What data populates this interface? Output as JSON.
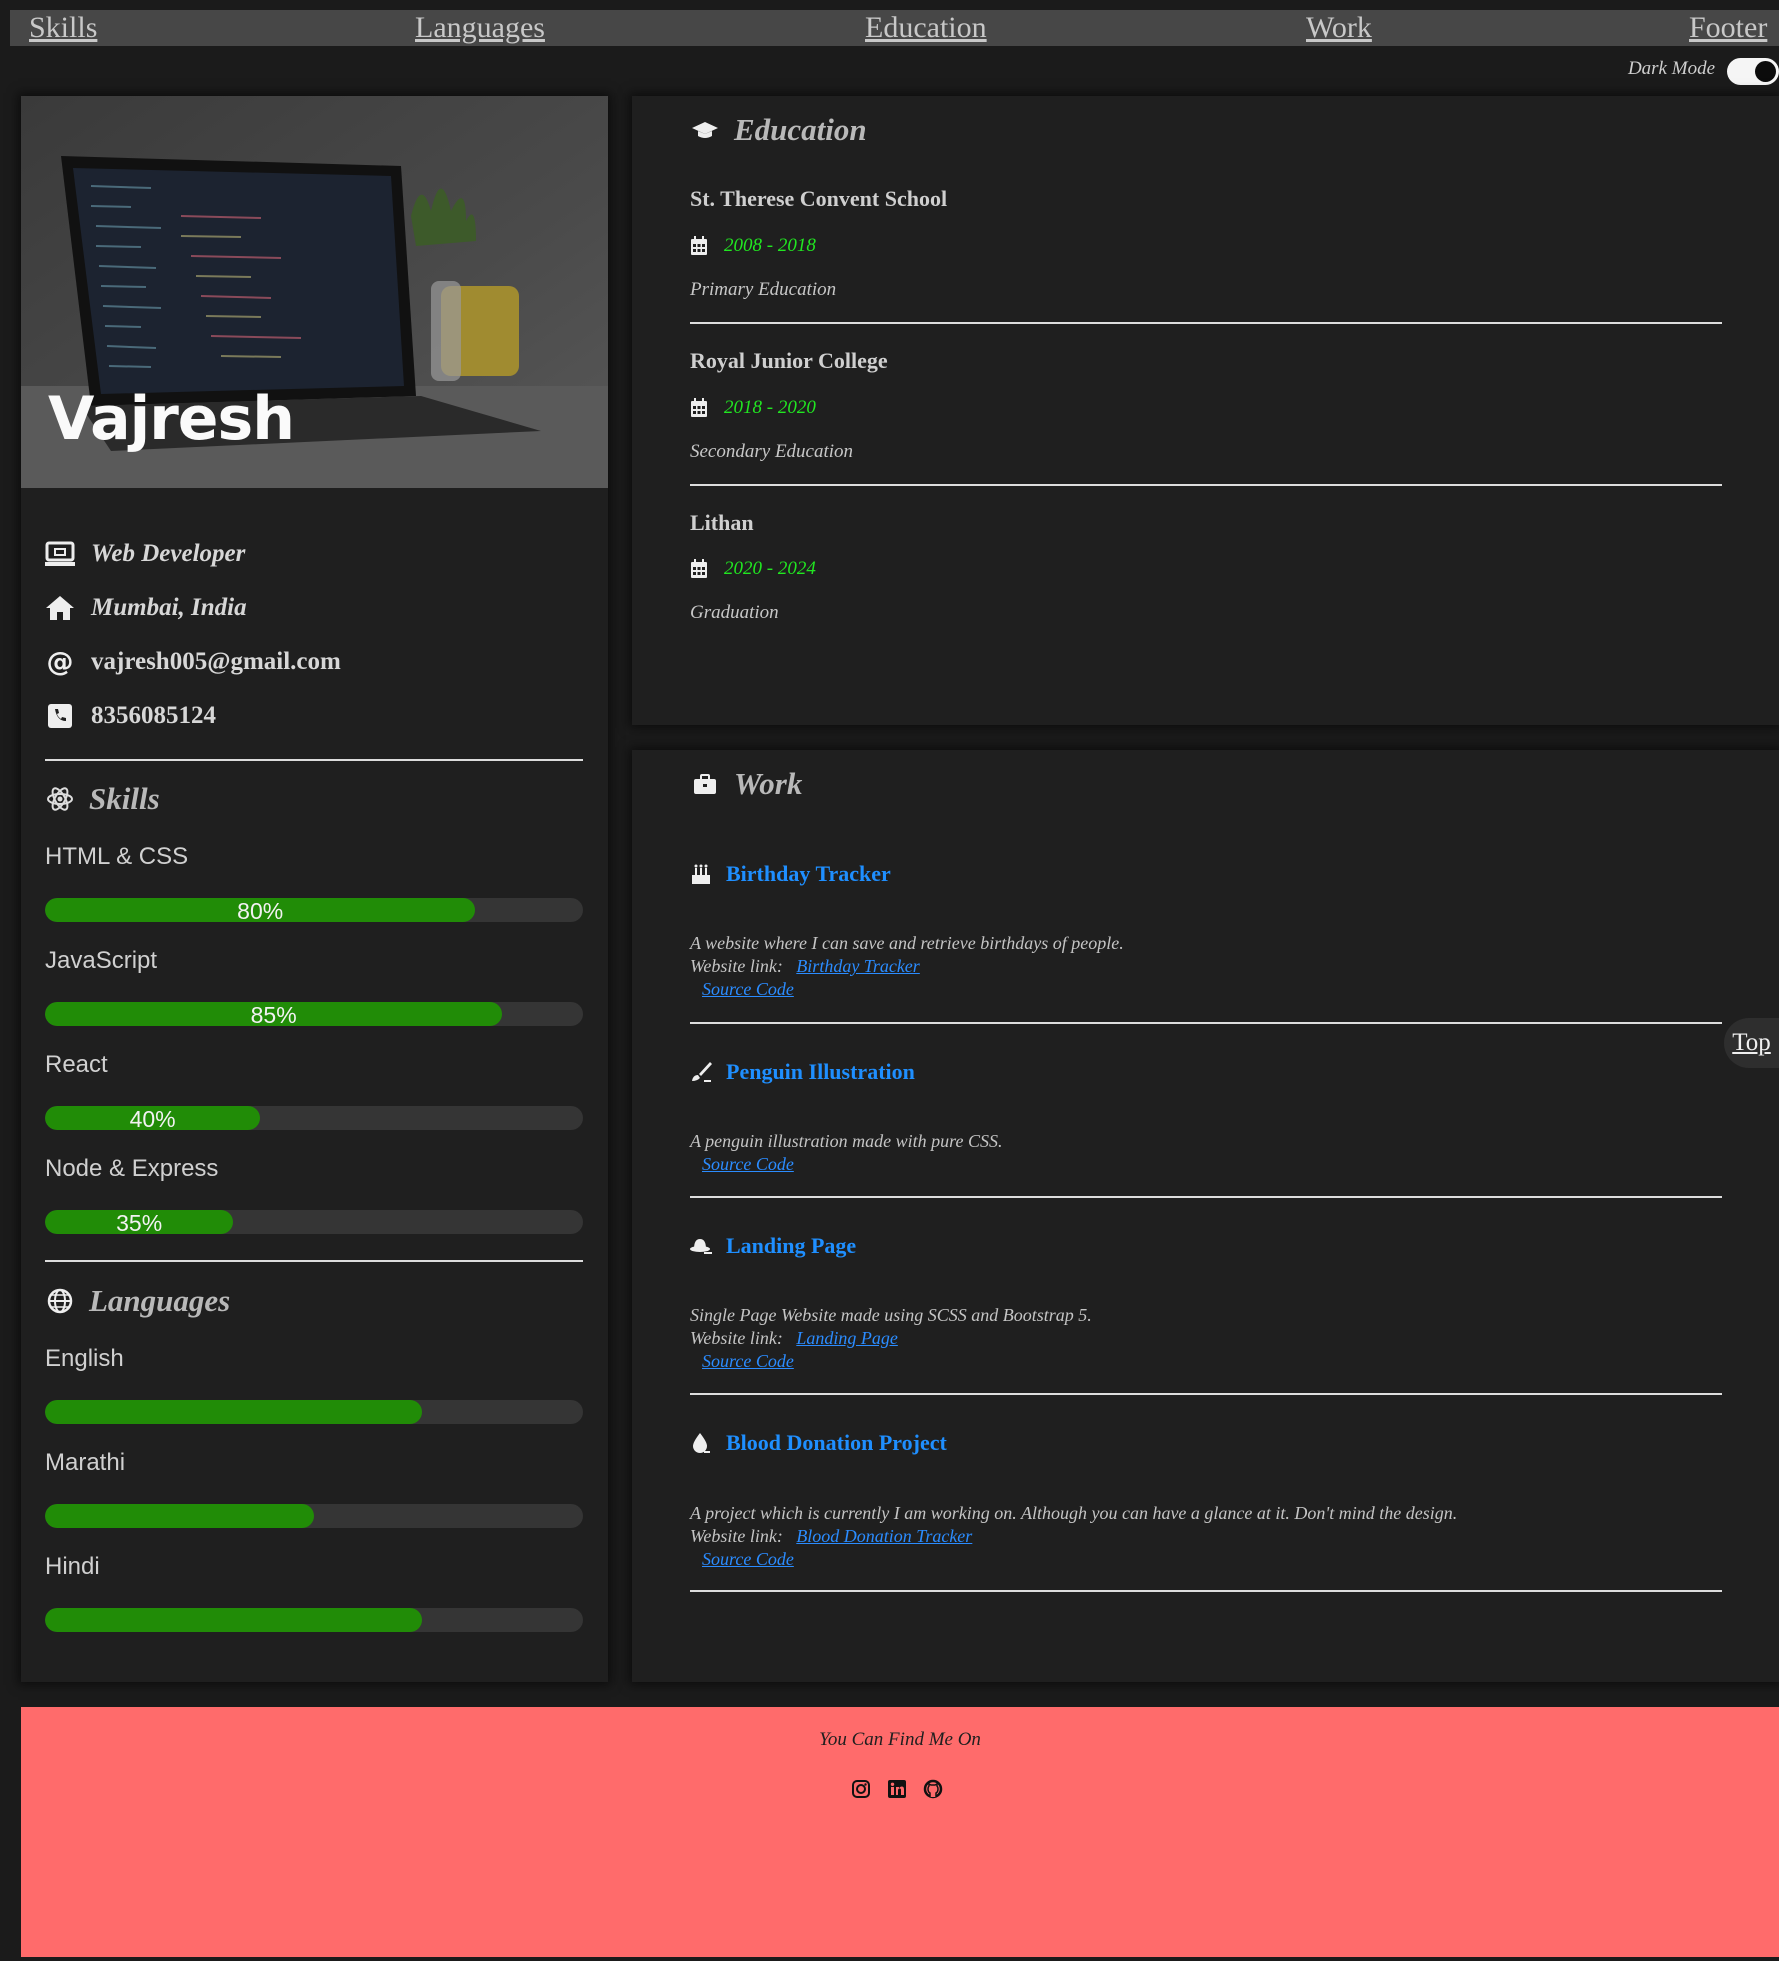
{
  "nav": {
    "items": [
      "Skills",
      "Languages",
      "Education",
      "Work",
      "Footer"
    ]
  },
  "dark_mode": {
    "label": "Dark Mode",
    "enabled": true
  },
  "profile": {
    "name": "Vajresh",
    "hero_icon": "laptop-photo",
    "info": [
      {
        "icon": "computer-icon",
        "text": "Web Developer"
      },
      {
        "icon": "home-icon",
        "text": "Mumbai, India"
      },
      {
        "icon": "at-icon",
        "text": "vajresh005@gmail.com"
      },
      {
        "icon": "phone-icon",
        "text": "8356085124"
      }
    ]
  },
  "skills": {
    "title": "Skills",
    "items": [
      {
        "name": "HTML & CSS",
        "percent": 80,
        "label": "80%"
      },
      {
        "name": "JavaScript",
        "percent": 85,
        "label": "85%"
      },
      {
        "name": "React",
        "percent": 40,
        "label": "40%"
      },
      {
        "name": "Node & Express",
        "percent": 35,
        "label": "35%"
      }
    ]
  },
  "languages": {
    "title": "Languages",
    "items": [
      {
        "name": "English",
        "percent": 70
      },
      {
        "name": "Marathi",
        "percent": 50
      },
      {
        "name": "Hindi",
        "percent": 70
      }
    ]
  },
  "education": {
    "title": "Education",
    "entries": [
      {
        "school": "St. Therese Convent School",
        "years": "2008 - 2018",
        "desc": "Primary Education"
      },
      {
        "school": "Royal Junior College",
        "years": "2018 - 2020",
        "desc": "Secondary Education"
      },
      {
        "school": "Lithan",
        "years": "2020 - 2024",
        "desc": "Graduation"
      }
    ]
  },
  "work": {
    "title": "Work",
    "link_prefix": "Website link:",
    "projects": [
      {
        "icon": "cake-icon",
        "title": "Birthday Tracker",
        "desc": "A website where I can save and retrieve birthdays of people.",
        "website_link": "Birthday Tracker",
        "source": "Source Code"
      },
      {
        "icon": "brush-icon",
        "title": "Penguin Illustration",
        "desc": "A penguin illustration made with pure CSS.",
        "website_link": null,
        "source": "Source Code"
      },
      {
        "icon": "hat-icon",
        "title": "Landing Page",
        "desc": "Single Page Website made using SCSS and Bootstrap 5.",
        "website_link": "Landing Page",
        "source": "Source Code"
      },
      {
        "icon": "drop-icon",
        "title": "Blood Donation Project",
        "desc": "A project which is currently I am working on. Although you can have a glance at it. Don't mind the design.",
        "website_link": "Blood Donation Tracker",
        "source": "Source Code"
      }
    ]
  },
  "top_button": "Top",
  "footer": {
    "text": "You Can Find Me On",
    "icons": [
      "instagram-icon",
      "linkedin-icon",
      "github-icon"
    ],
    "background": "#ff6b6b"
  },
  "colors": {
    "bar_fill": "#218c07",
    "date_green": "#21e621",
    "link_blue": "#1f8fff"
  }
}
